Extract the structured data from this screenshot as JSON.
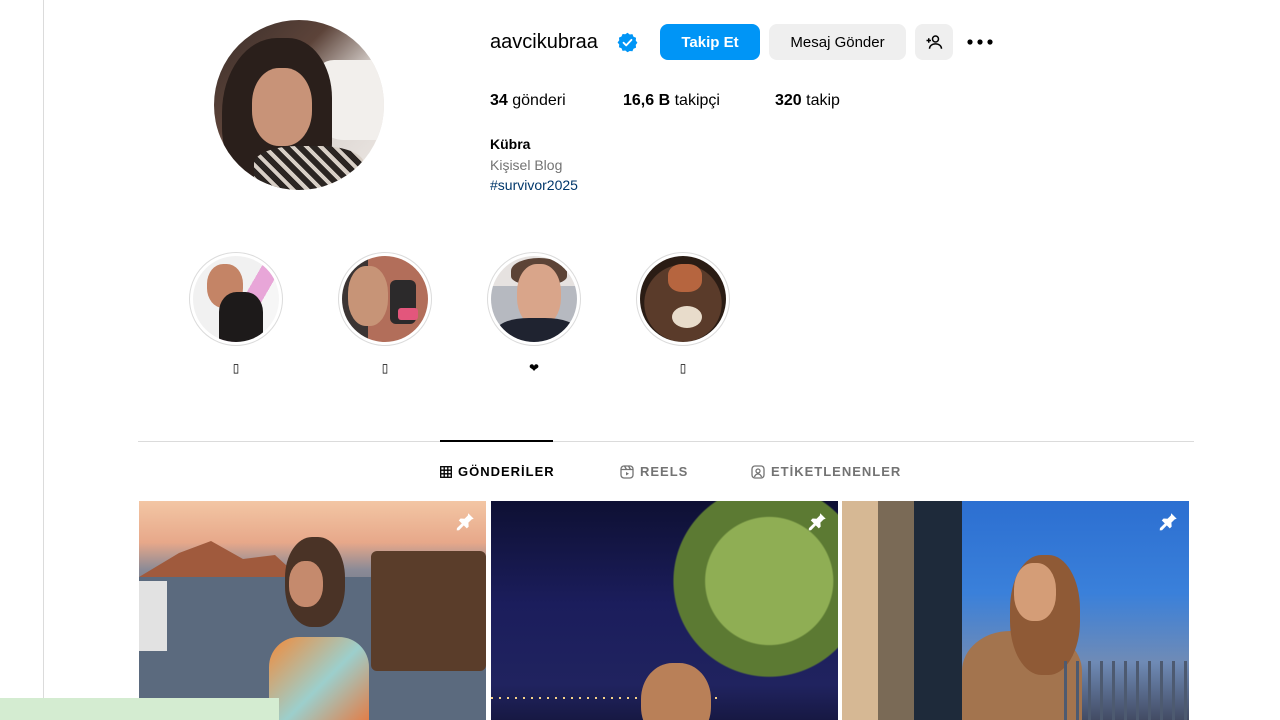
{
  "profile": {
    "username": "aavcikubraa",
    "verified": true,
    "buttons": {
      "follow": "Takip Et",
      "message": "Mesaj Gönder"
    },
    "stats": {
      "posts_count": "34",
      "posts_label": "gönderi",
      "followers_count": "16,6 B",
      "followers_label": "takipçi",
      "following_count": "320",
      "following_label": "takip"
    },
    "full_name": "Kübra",
    "category": "Kişisel Blog",
    "bio_hashtag": "#survivor2025"
  },
  "highlights": [
    {
      "label": "▯"
    },
    {
      "label": "▯"
    },
    {
      "label": "❤"
    },
    {
      "label": "▯"
    }
  ],
  "tabs": [
    {
      "label": "GÖNDERİLER",
      "icon": "grid-icon",
      "active": true
    },
    {
      "label": "REELS",
      "icon": "reels-icon",
      "active": false
    },
    {
      "label": "ETİKETLENENLER",
      "icon": "tagged-icon",
      "active": false
    }
  ],
  "posts": [
    {
      "pinned": true
    },
    {
      "pinned": true
    },
    {
      "pinned": true
    }
  ],
  "colors": {
    "accent": "#0095f6",
    "verified": "#0095f6",
    "secondary_button": "#efefef",
    "hashtag": "#00376b",
    "muted_text": "#737373"
  }
}
